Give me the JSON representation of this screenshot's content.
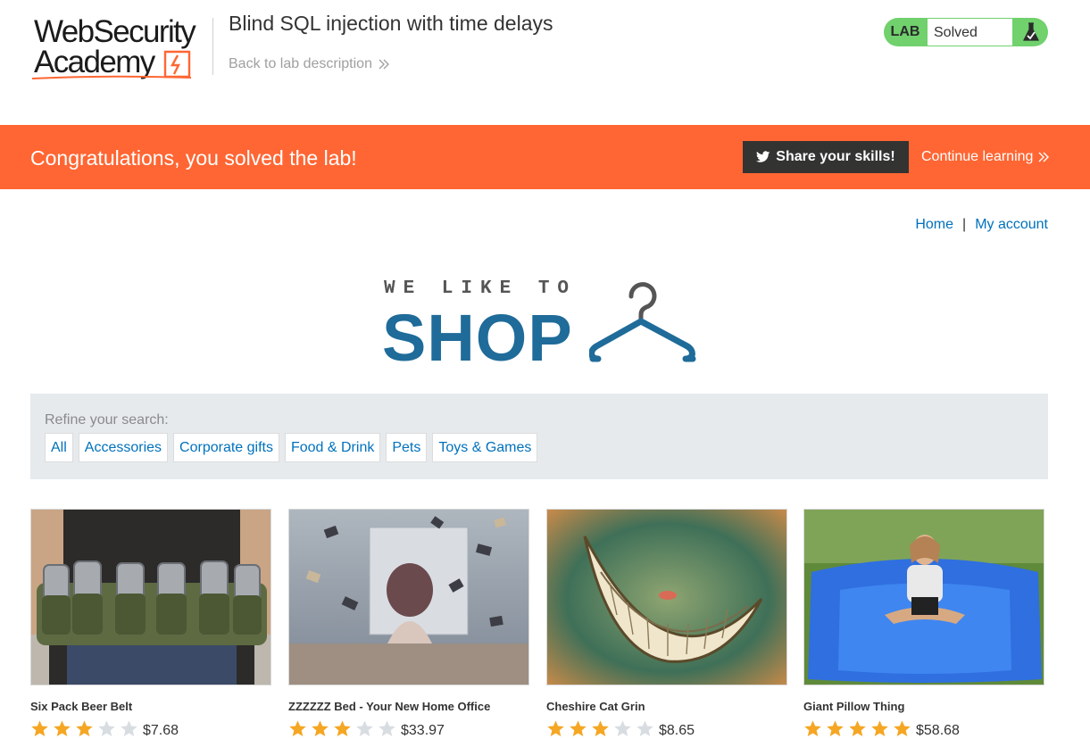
{
  "academy": {
    "logo_line1": "WebSecurity",
    "logo_line2": "Academy",
    "lab_title": "Blind SQL injection with time delays",
    "back_link": "Back to lab description",
    "lab_badge": "LAB",
    "lab_status": "Solved"
  },
  "banner": {
    "message": "Congratulations, you solved the lab!",
    "share_label": "Share your skills!",
    "continue_label": "Continue learning"
  },
  "nav": {
    "home": "Home",
    "separator": "|",
    "account": "My account"
  },
  "shop_logo": {
    "tagline": "WE LIKE TO",
    "word": "SHOP"
  },
  "filter": {
    "label": "Refine your search:",
    "categories": [
      "All",
      "Accessories",
      "Corporate gifts",
      "Food & Drink",
      "Pets",
      "Toys & Games"
    ]
  },
  "products": [
    {
      "name": "Six Pack Beer Belt",
      "rating": 3,
      "price": "$7.68",
      "image": "beer-belt"
    },
    {
      "name": "ZZZZZZ Bed - Your New Home Office",
      "rating": 3,
      "price": "$33.97",
      "image": "flying-books"
    },
    {
      "name": "Cheshire Cat Grin",
      "rating": 3,
      "price": "$8.65",
      "image": "cat-grin"
    },
    {
      "name": "Giant Pillow Thing",
      "rating": 5,
      "price": "$58.68",
      "image": "giant-pillow"
    }
  ],
  "colors": {
    "banner": "#ff6633",
    "link": "#0071bc",
    "lab_solved": "#70d16d",
    "shop_blue": "#1f6b99",
    "star_on": "#f5a623",
    "star_off": "#d8dde2"
  },
  "icons": {
    "back": "chevron-double-right-icon",
    "flask": "flask-icon",
    "twitter": "twitter-icon",
    "continue": "chevron-double-right-icon",
    "hanger": "hanger-icon",
    "star": "star-icon"
  }
}
